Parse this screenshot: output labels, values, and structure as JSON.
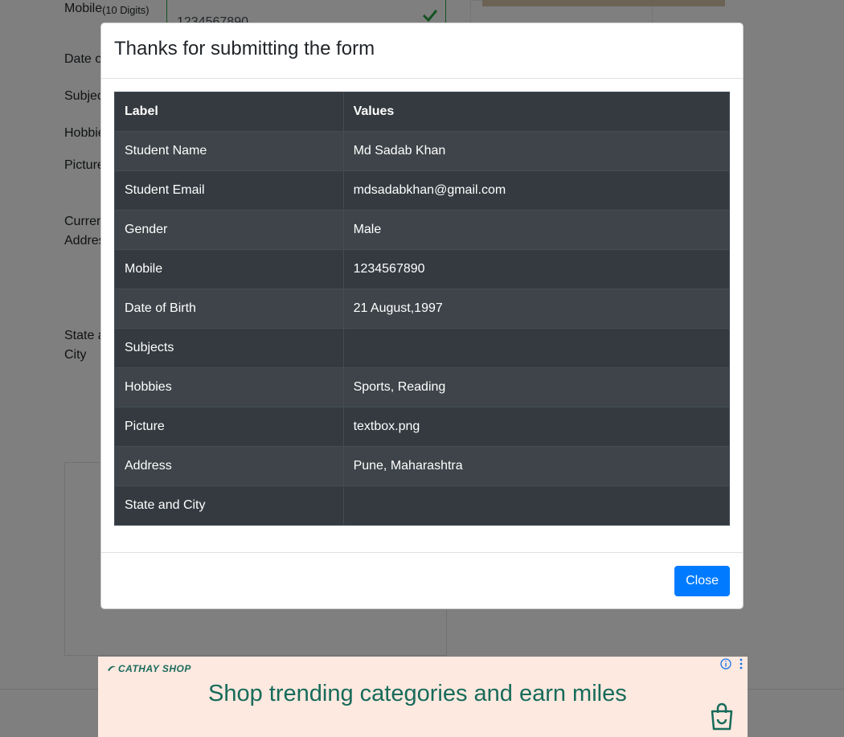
{
  "background_form": {
    "mobile_label": "Mobile",
    "mobile_hint": "(10 Digits)",
    "mobile_value": "1234567890",
    "dob_label": "Date o",
    "subjects_label": "Subjec",
    "hobbies_label": "Hobbie",
    "picture_label": "Picture",
    "address_label_1": "Curren",
    "address_label_2": "Addres",
    "state_label_1": "State a",
    "state_label_2": "City"
  },
  "modal": {
    "title": "Thanks for submitting the form",
    "table": {
      "headers": [
        "Label",
        "Values"
      ],
      "rows": [
        {
          "label": "Student Name",
          "value": "Md Sadab Khan"
        },
        {
          "label": "Student Email",
          "value": "mdsadabkhan@gmail.com"
        },
        {
          "label": "Gender",
          "value": "Male"
        },
        {
          "label": "Mobile",
          "value": "1234567890"
        },
        {
          "label": "Date of Birth",
          "value": "21 August,1997"
        },
        {
          "label": "Subjects",
          "value": ""
        },
        {
          "label": "Hobbies",
          "value": "Sports, Reading"
        },
        {
          "label": "Picture",
          "value": "textbox.png"
        },
        {
          "label": "Address",
          "value": "Pune, Maharashtra"
        },
        {
          "label": "State and City",
          "value": ""
        }
      ]
    },
    "close_label": "Close"
  },
  "ad": {
    "brand": "CATHAY SHOP",
    "headline": "Shop trending categories and earn miles"
  },
  "colors": {
    "primary": "#007bff",
    "table_dark": "#343a40",
    "valid_green": "#28a745",
    "ad_bg": "#fde9df",
    "ad_text": "#176b5b"
  }
}
